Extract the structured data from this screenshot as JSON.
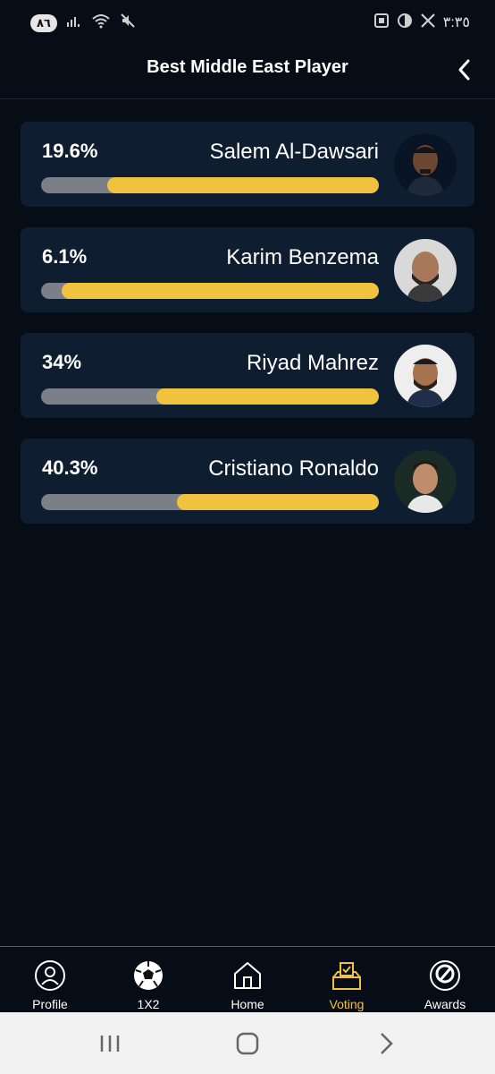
{
  "status_bar": {
    "badge": "٨٦",
    "time": "٣:٣٥"
  },
  "header": {
    "title": "Best Middle East Player"
  },
  "players": [
    {
      "name": "Salem Al-Dawsari",
      "percent_label": "19.6%",
      "percent": 19.6
    },
    {
      "name": "Karim Benzema",
      "percent_label": "6.1%",
      "percent": 6.1
    },
    {
      "name": "Riyad Mahrez",
      "percent_label": "34%",
      "percent": 34
    },
    {
      "name": "Cristiano Ronaldo",
      "percent_label": "40.3%",
      "percent": 40.3
    }
  ],
  "nav": {
    "profile": "Profile",
    "x12": "1X2",
    "home": "Home",
    "voting": "Voting",
    "awards": "Awards",
    "active": "voting"
  },
  "colors": {
    "accent": "#f0c23e",
    "card": "#0f1d31",
    "background": "#070d17",
    "bar_track": "#7a7f88"
  }
}
